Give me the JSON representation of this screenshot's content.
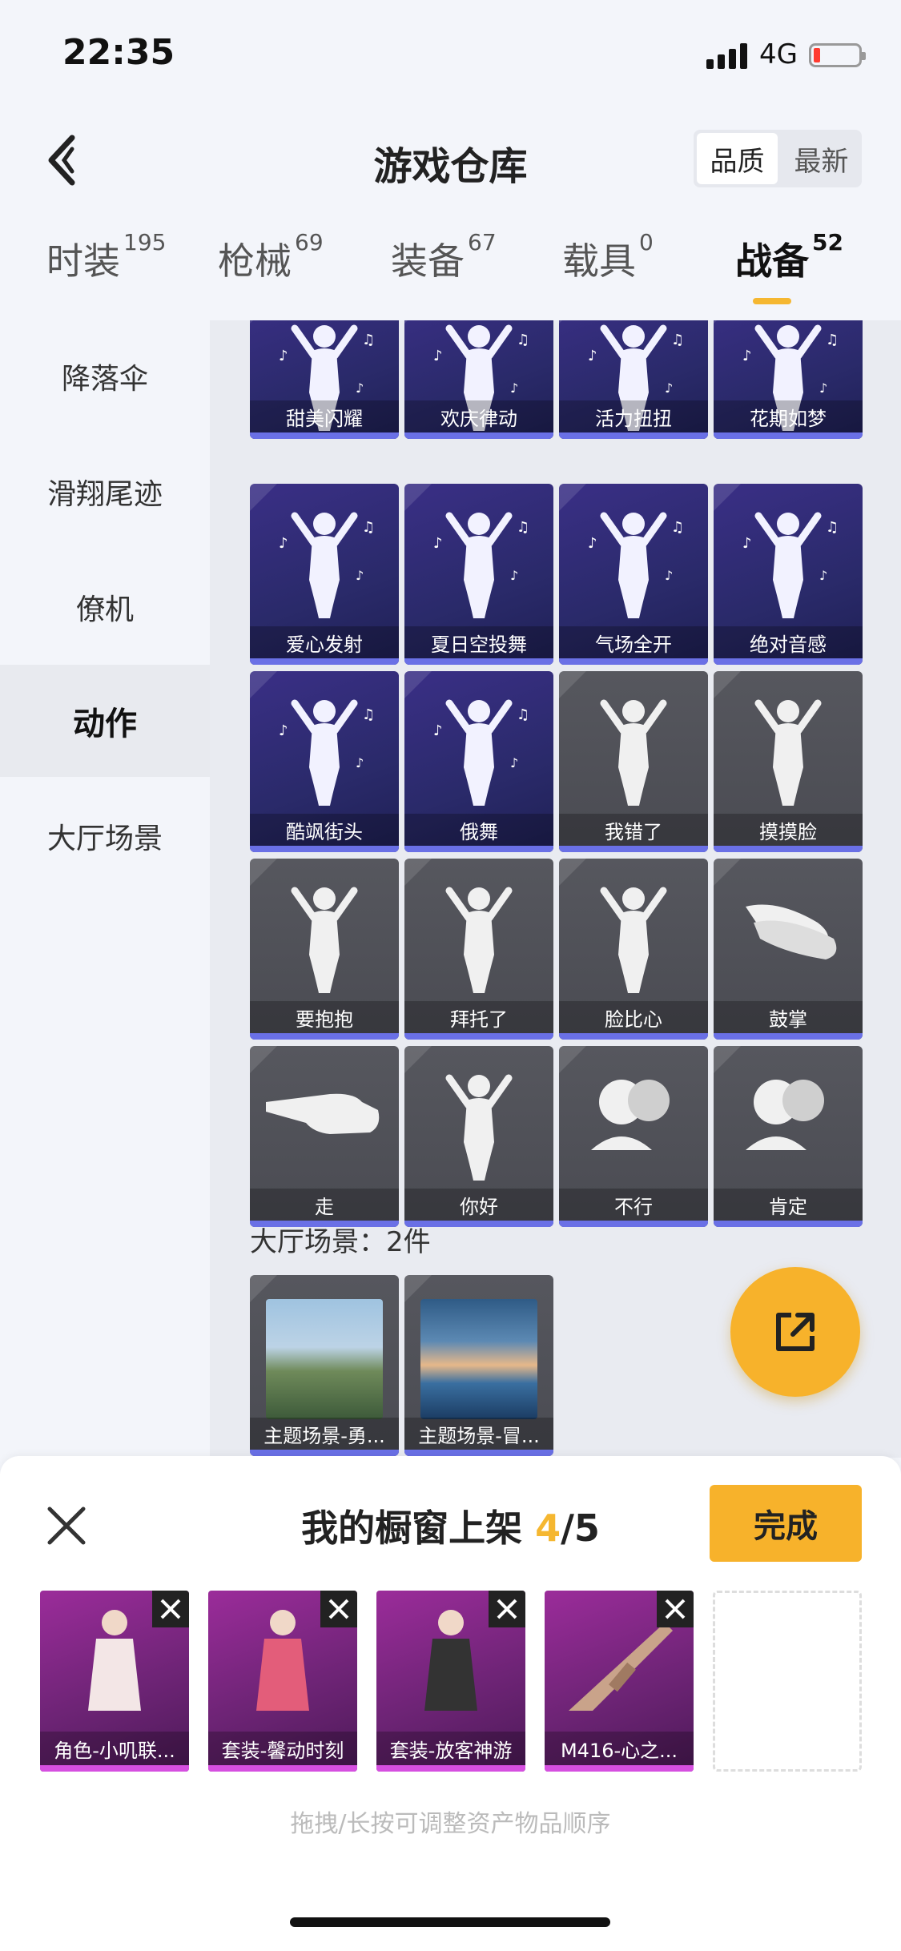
{
  "status_bar": {
    "time": "22:35",
    "network": "4G"
  },
  "header": {
    "title": "游戏仓库",
    "sort_options": [
      "品质",
      "最新"
    ]
  },
  "tabs": [
    {
      "label": "时装",
      "count": "195"
    },
    {
      "label": "枪械",
      "count": "69"
    },
    {
      "label": "装备",
      "count": "67"
    },
    {
      "label": "载具",
      "count": "0"
    },
    {
      "label": "战备",
      "count": "52"
    }
  ],
  "sidebar": {
    "items": [
      "降落伞",
      "滑翔尾迹",
      "僚机",
      "动作",
      "大厅场景"
    ]
  },
  "emotes": [
    "甜美闪耀",
    "欢庆律动",
    "活力扭扭",
    "花期如梦",
    "爱心发射",
    "夏日空投舞",
    "气场全开",
    "绝对音感",
    "酷飒街头",
    "俄舞",
    "我错了",
    "摸摸脸",
    "要抱抱",
    "拜托了",
    "脸比心",
    "鼓掌",
    "走",
    "你好",
    "不行",
    "肯定"
  ],
  "scene_section": {
    "label": "大厅场景：2件",
    "items": [
      "主题场景-勇...",
      "主题场景-冒..."
    ]
  },
  "panel": {
    "title_prefix": "我的橱窗上架",
    "count": "4",
    "total": "/5",
    "done_label": "完成",
    "items": [
      "角色-小叽联...",
      "套装-馨动时刻",
      "套装-放客神游",
      "M416-心之..."
    ],
    "hint": "拖拽/长按可调整资产物品顺序"
  },
  "colors": {
    "accent": "#f7b22b",
    "purple_card": "#3a2f86",
    "gray_card": "#4e4f56",
    "shelf_card": "#7a2680"
  }
}
